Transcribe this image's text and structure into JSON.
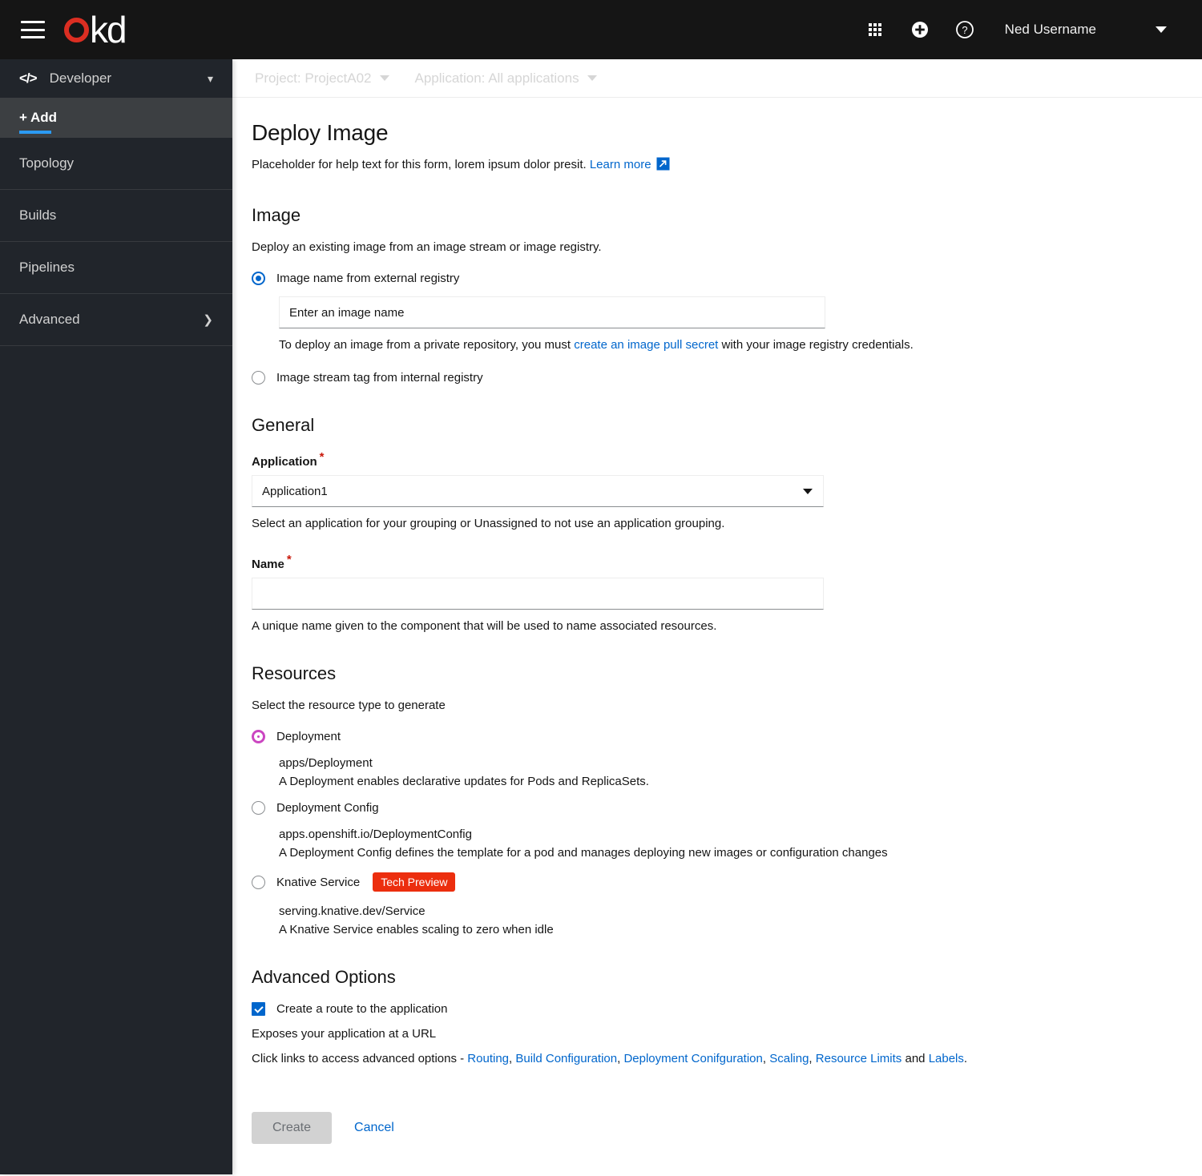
{
  "masthead": {
    "menu_icon": "hamburger-icon",
    "logo_text_o": "o",
    "logo_text_kd": "kd",
    "apps_icon": "grid-apps-icon",
    "add_icon": "plus-circle-icon",
    "help_icon": "question-circle-icon",
    "username": "Ned Username",
    "user_caret": "caret-down-icon"
  },
  "sidebar": {
    "perspective": "Developer",
    "perspective_icon": "code-icon",
    "items": [
      {
        "label": "+ Add",
        "active": true
      },
      {
        "label": "Topology",
        "active": false
      },
      {
        "label": "Builds",
        "active": false
      },
      {
        "label": "Pipelines",
        "active": false
      },
      {
        "label": "Advanced",
        "active": false,
        "chevron": "chevron-right-icon"
      }
    ]
  },
  "context_bar": {
    "project": "Project: ProjectA02",
    "application": "Application: All applications"
  },
  "page": {
    "title": "Deploy Image",
    "help_text": "Placeholder for help text for this form, lorem ipsum dolor presit.",
    "learn_more": "Learn more"
  },
  "image_section": {
    "title": "Image",
    "description": "Deploy an existing image from an image stream or image registry.",
    "option_external": "Image name from external registry",
    "option_external_selected": true,
    "image_name_placeholder": "Enter an image name",
    "image_name_value": "",
    "pull_secret_pre": "To deploy an image from a private repository, you must ",
    "pull_secret_link": "create an image pull secret",
    "pull_secret_post": " with your image registry credentials.",
    "option_internal": "Image stream tag from internal registry",
    "option_internal_selected": false
  },
  "general_section": {
    "title": "General",
    "application_label": "Application",
    "application_required": "*",
    "application_value": "Application1",
    "application_help": "Select an application for your grouping or Unassigned to not use an application grouping.",
    "name_label": "Name",
    "name_required": "*",
    "name_value": "",
    "name_placeholder": "",
    "name_help": "A unique name given to the component that will be used to name associated resources."
  },
  "resources_section": {
    "title": "Resources",
    "description": "Select the resource type to generate",
    "options": [
      {
        "label": "Deployment",
        "selected": true,
        "api": "apps/Deployment",
        "desc": "A Deployment enables declarative updates for Pods and ReplicaSets.",
        "badge": null
      },
      {
        "label": "Deployment Config",
        "selected": false,
        "api": "apps.openshift.io/DeploymentConfig",
        "desc": "A Deployment Config defines the template for a pod and manages deploying new images or configuration changes",
        "badge": null
      },
      {
        "label": "Knative Service",
        "selected": false,
        "api": "serving.knative.dev/Service",
        "desc": "A Knative Service enables scaling to zero when idle",
        "badge": "Tech Preview"
      }
    ]
  },
  "advanced_section": {
    "title": "Advanced Options",
    "route_checkbox_label": "Create a route to the application",
    "route_checked": true,
    "route_help": "Exposes your application at a URL",
    "links_prefix": "Click links to access advanced options - ",
    "links": [
      "Routing",
      "Build Configuration",
      "Deployment Conifguration",
      "Scaling",
      "Resource Limits"
    ],
    "links_conjunction": " and ",
    "links_last": "Labels",
    "links_suffix": "."
  },
  "footer": {
    "create_label": "Create",
    "create_disabled": true,
    "cancel_label": "Cancel"
  },
  "colors": {
    "masthead_bg": "#151515",
    "sidebar_bg": "#21252b",
    "sidebar_active_bg": "#3c3f42",
    "accent_blue": "#0066cc",
    "active_underline": "#2b9af3",
    "logo_red": "#db2e22",
    "badge_red": "#ec2e0e",
    "radio_magenta": "#cb46c1",
    "required_red": "#c9190b"
  }
}
